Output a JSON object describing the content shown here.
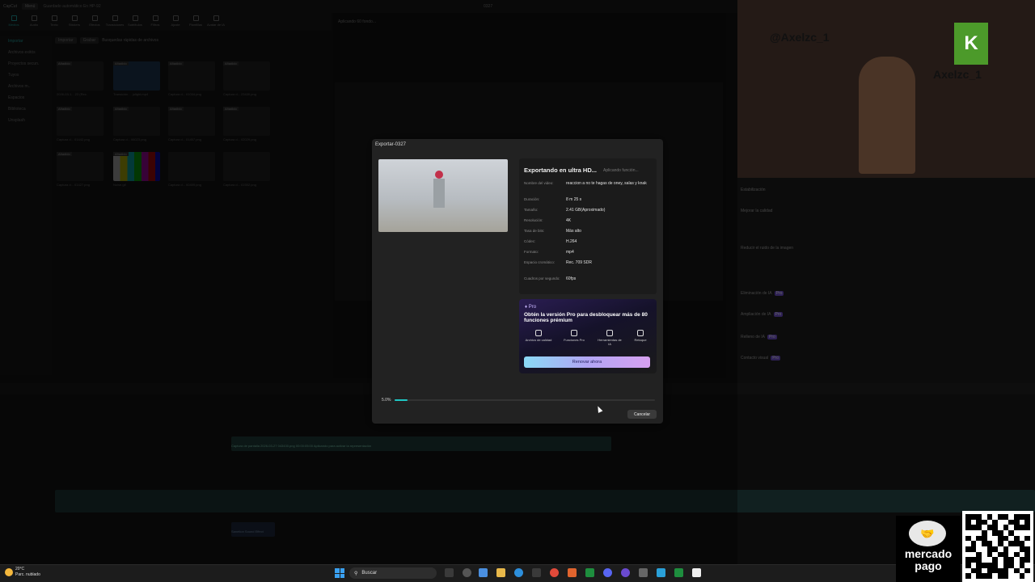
{
  "app": {
    "name": "CapCut",
    "menu": "Menú",
    "project_status": "Guardado automático En HP-92",
    "window_title": "0327"
  },
  "toolbar": [
    "Medios",
    "Audio",
    "Texto",
    "Stickers",
    "Efectos",
    "Transiciones",
    "Subtítulos",
    "Filtros",
    "Ajuste",
    "Plantillas",
    "Avatar de IA"
  ],
  "left_nav": [
    "Importar",
    "Archivos exitós",
    "Proyectos secun.",
    "Tuyos",
    "Archivos m..",
    "Espacios",
    "Biblioteca",
    "Unsplash"
  ],
  "media_bar": {
    "import": "Importar",
    "record": "Grabar",
    "search_placeholder": "Busquedas rápidas de archivos"
  },
  "preview_header": "Aplicando 60 fondo...",
  "media_items": [
    {
      "badge": "Añadido",
      "caption": "2026-03-1... 23 (Rec."
    },
    {
      "badge": "Añadido",
      "caption": "Transición ... julight.mp4"
    },
    {
      "badge": "Añadido",
      "caption": "Captura d... 01034.png"
    },
    {
      "badge": "Añadido",
      "caption": "Captura d... 23430.png"
    },
    {
      "badge": "Añadido",
      "caption": "Captura d... 01442.png"
    },
    {
      "badge": "Añadido",
      "caption": "Captura d... 06023.png"
    },
    {
      "badge": "Añadido",
      "caption": "Captura d... 01457.png"
    },
    {
      "badge": "Añadido",
      "caption": "Captura d... 02029.png"
    },
    {
      "badge": "Añadido",
      "caption": "Captura d... 01427.png"
    },
    {
      "badge": "Añadido",
      "caption": "Noise.gif"
    },
    {
      "badge": "",
      "caption": "Captura d... 00459.png"
    },
    {
      "badge": "",
      "caption": "Captura d... 01552.png"
    }
  ],
  "right_panel": [
    {
      "label": "Estabilización",
      "tag": ""
    },
    {
      "label": "Mejorar la calidad",
      "tag": ""
    },
    {
      "label": "Reducir el ruido de la imagen",
      "tag": ""
    },
    {
      "label": "Eliminación de IA",
      "tag": "Pro"
    },
    {
      "label": "Ampliación de IA",
      "tag": "Pro"
    },
    {
      "label": "Relleno de IA",
      "tag": "Pro"
    },
    {
      "label": "Contacto visual",
      "tag": "Pro"
    }
  ],
  "webcam": {
    "instagram": "@Axelzc_1",
    "name": "Axelzc_1",
    "sponsor_text": "mercado pago"
  },
  "export_dialog": {
    "title": "Exportar-0327",
    "heading": "Exportando en ultra HD...",
    "subheading": "Aplicando función...",
    "fields": [
      {
        "key": "Nombre del video:",
        "value": "reaccion a no te hagas de oney, salas y knak"
      },
      {
        "key": "Duración:",
        "value": "8 m 25 s"
      },
      {
        "key": "Tamaño:",
        "value": "2.41 GB(Aproximado)"
      },
      {
        "key": "Resolución:",
        "value": "4K"
      },
      {
        "key": "Tasa de bits:",
        "value": "Más alto"
      },
      {
        "key": "Códec:",
        "value": "H.264"
      },
      {
        "key": "Formato:",
        "value": "mp4"
      },
      {
        "key": "Espacio cromático:",
        "value": "Rec. 709 SDR"
      },
      {
        "key": "Cuadros por segundo:",
        "value": "60fps"
      }
    ],
    "pro": {
      "badge": "Pro",
      "title": "Obtén la versión Pro para desbloquear más de 80 funciones prémium",
      "features": [
        "Archivo de calidad",
        "Funciones Pro",
        "Herramientas de IA",
        "Retoque"
      ],
      "renew_button": "Renovar ahora"
    },
    "progress": {
      "percent_text": "5.0%",
      "value": 0.05
    },
    "cancel_button": "Cancelar"
  },
  "timeline": {
    "clip_caption": "Captura de pantalla 2026-03-27 043430.png 00:00:05:00 Aplicando para activar la representación",
    "audio_caption": "Sanetion Sound Effect",
    "timecode": "00:03:34:24"
  },
  "taskbar": {
    "temp": "20°C",
    "weather": "Parc. nublado",
    "search": "Buscar"
  },
  "sponsor": {
    "line1": "mercado",
    "line2": "pago"
  },
  "colors": {
    "accent": "#1fc7c4",
    "pro_purple": "#6b4fd6",
    "renew_gradient_start": "#8ad9f5"
  }
}
